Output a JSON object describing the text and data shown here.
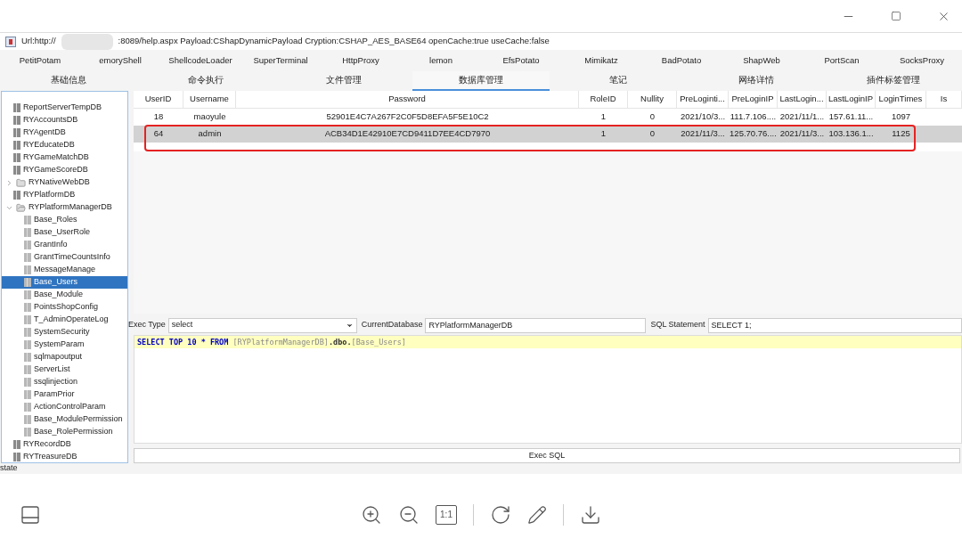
{
  "url_bar": {
    "prefix": "Url:http://",
    "rest": ":8089/help.aspx Payload:CShapDynamicPayload Cryption:CSHAP_AES_BASE64 openCache:true useCache:false"
  },
  "plugin_tabs": [
    "PetitPotam",
    "emoryShell",
    "ShellcodeLoader",
    "SuperTerminal",
    "HttpProxy",
    "lemon",
    "EfsPotato",
    "Mimikatz",
    "BadPotato",
    "ShapWeb",
    "PortScan",
    "SocksProxy"
  ],
  "main_tabs": [
    {
      "label": "基础信息",
      "selected": false
    },
    {
      "label": "命令执行",
      "selected": false
    },
    {
      "label": "文件管理",
      "selected": false
    },
    {
      "label": "数据库管理",
      "selected": true
    },
    {
      "label": "笔记",
      "selected": false
    },
    {
      "label": "网络详情",
      "selected": false
    },
    {
      "label": "插件标签管理",
      "selected": false
    }
  ],
  "tree": [
    {
      "label": "ReportServerTempDB",
      "kind": "db",
      "selected": false
    },
    {
      "label": "RYAccountsDB",
      "kind": "db",
      "selected": false
    },
    {
      "label": "RYAgentDB",
      "kind": "db",
      "selected": false
    },
    {
      "label": "RYEducateDB",
      "kind": "db",
      "selected": false
    },
    {
      "label": "RYGameMatchDB",
      "kind": "db",
      "selected": false
    },
    {
      "label": "RYGameScoreDB",
      "kind": "db",
      "selected": false
    },
    {
      "label": "RYNativeWebDB",
      "kind": "folder",
      "expanded": false,
      "selected": false
    },
    {
      "label": "RYPlatformDB",
      "kind": "db",
      "selected": false
    },
    {
      "label": "RYPlatformManagerDB",
      "kind": "folder",
      "expanded": true,
      "selected": false,
      "children": [
        {
          "label": "Base_Roles",
          "kind": "table",
          "selected": false
        },
        {
          "label": "Base_UserRole",
          "kind": "table",
          "selected": false
        },
        {
          "label": "GrantInfo",
          "kind": "table",
          "selected": false
        },
        {
          "label": "GrantTimeCountsInfo",
          "kind": "table",
          "selected": false
        },
        {
          "label": "MessageManage",
          "kind": "table",
          "selected": false
        },
        {
          "label": "Base_Users",
          "kind": "table",
          "selected": true
        },
        {
          "label": "Base_Module",
          "kind": "table",
          "selected": false
        },
        {
          "label": "PointsShopConfig",
          "kind": "table",
          "selected": false
        },
        {
          "label": "T_AdminOperateLog",
          "kind": "table",
          "selected": false
        },
        {
          "label": "SystemSecurity",
          "kind": "table",
          "selected": false
        },
        {
          "label": "SystemParam",
          "kind": "table",
          "selected": false
        },
        {
          "label": "sqlmapoutput",
          "kind": "table",
          "selected": false
        },
        {
          "label": "ServerList",
          "kind": "table",
          "selected": false
        },
        {
          "label": "ssqlinjection",
          "kind": "table",
          "selected": false
        },
        {
          "label": "ParamPrior",
          "kind": "table",
          "selected": false
        },
        {
          "label": "ActionControlParam",
          "kind": "table",
          "selected": false
        },
        {
          "label": "Base_ModulePermission",
          "kind": "table",
          "selected": false
        },
        {
          "label": "Base_RolePermission",
          "kind": "table",
          "selected": false
        }
      ]
    },
    {
      "label": "RYRecordDB",
      "kind": "db",
      "selected": false
    },
    {
      "label": "RYTreasureDB",
      "kind": "db",
      "selected": false
    }
  ],
  "table": {
    "columns": [
      "UserID",
      "Username",
      "Password",
      "RoleID",
      "Nullity",
      "PreLoginti...",
      "PreLoginIP",
      "LastLogin...",
      "LastLoginIP",
      "LoginTimes",
      "Is"
    ],
    "rows": [
      {
        "selected": false,
        "outlined": false,
        "cells": [
          "18",
          "maoyule",
          "52901E4C7A267F2C0F5D8EFA5F5E10C2",
          "1",
          "0",
          "2021/10/3...",
          "111.7.106....",
          "2021/11/1...",
          "157.61.11...",
          "1097"
        ]
      },
      {
        "selected": true,
        "outlined": true,
        "cells": [
          "64",
          "admin",
          "ACB34D1E42910E7CD9411D7EE4CD7970",
          "1",
          "0",
          "2021/11/3...",
          "125.70.76....",
          "2021/11/3...",
          "103.136.1...",
          "1125"
        ]
      }
    ]
  },
  "query_bar": {
    "exec_type_label": "Exec Type",
    "exec_type": "select",
    "database_label": "CurrentDatabase",
    "database": "RYPlatformManagerDB",
    "statement_label": "SQL Statement",
    "statement": "SELECT 1;"
  },
  "editor": {
    "tokens": [
      {
        "text": "SELECT TOP 10 * FROM ",
        "kind": "keyword"
      },
      {
        "text": "[RYPlatformManagerDB]",
        "kind": "name"
      },
      {
        "text": ".dbo.",
        "kind": "plain"
      },
      {
        "text": "[Base_Users]",
        "kind": "name"
      }
    ]
  },
  "exec_button": "Exec SQL",
  "status": "state",
  "viewer_toolbar": {
    "actual_size": "1:1"
  }
}
